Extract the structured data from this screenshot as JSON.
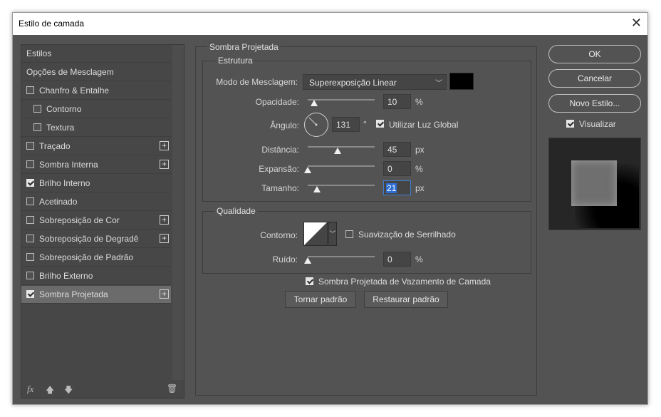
{
  "window": {
    "title": "Estilo de camada"
  },
  "left_panel": {
    "items": [
      {
        "label": "Estilos",
        "checkbox": null,
        "plus": false,
        "selected": false
      },
      {
        "label": "Opções de Mesclagem",
        "checkbox": null,
        "plus": false,
        "selected": false
      },
      {
        "label": "Chanfro & Entalhe",
        "checkbox": false,
        "plus": false,
        "selected": false
      },
      {
        "label": "Contorno",
        "checkbox": false,
        "plus": false,
        "selected": false,
        "indent": true
      },
      {
        "label": "Textura",
        "checkbox": false,
        "plus": false,
        "selected": false,
        "indent": true
      },
      {
        "label": "Traçado",
        "checkbox": false,
        "plus": true,
        "selected": false
      },
      {
        "label": "Sombra Interna",
        "checkbox": false,
        "plus": true,
        "selected": false
      },
      {
        "label": "Brilho Interno",
        "checkbox": true,
        "plus": false,
        "selected": false
      },
      {
        "label": "Acetinado",
        "checkbox": false,
        "plus": false,
        "selected": false
      },
      {
        "label": "Sobreposição de Cor",
        "checkbox": false,
        "plus": true,
        "selected": false
      },
      {
        "label": "Sobreposição de Degradê",
        "checkbox": false,
        "plus": true,
        "selected": false
      },
      {
        "label": "Sobreposição de Padrão",
        "checkbox": false,
        "plus": false,
        "selected": false
      },
      {
        "label": "Brilho Externo",
        "checkbox": false,
        "plus": false,
        "selected": false
      },
      {
        "label": "Sombra Projetada",
        "checkbox": true,
        "plus": true,
        "selected": true
      }
    ],
    "footer": {
      "fx": "fx",
      "up_icon": "arrow-up-icon",
      "down_icon": "arrow-down-icon",
      "trash_icon": "trash-icon"
    }
  },
  "panel": {
    "group_title": "Sombra Projetada",
    "structure": {
      "title": "Estrutura",
      "blend_mode_label": "Modo de Mesclagem:",
      "blend_mode_value": "Superexposição Linear",
      "color": "#000000",
      "opacity_label": "Opacidade:",
      "opacity_value": "10",
      "opacity_unit": "%",
      "opacity_level": 0.1,
      "angle_label": "Ângulo:",
      "angle_value": "131",
      "angle_unit": "°",
      "global_light_label": "Utilizar Luz Global",
      "global_light_checked": true,
      "distance_label": "Distância:",
      "distance_value": "45",
      "distance_unit": "px",
      "distance_level": 0.45,
      "spread_label": "Expansão:",
      "spread_value": "0",
      "spread_unit": "%",
      "spread_level": 0,
      "size_label": "Tamanho:",
      "size_value": "21",
      "size_unit": "px",
      "size_level": 0.14
    },
    "quality": {
      "title": "Qualidade",
      "contour_label": "Contorno:",
      "antialias_label": "Suavização de Serrilhado",
      "antialias_checked": false,
      "noise_label": "Ruído:",
      "noise_value": "0",
      "noise_unit": "%",
      "noise_level": 0
    },
    "knockout_label": "Sombra Projetada de Vazamento de Camada",
    "knockout_checked": true,
    "make_default": "Tornar padrão",
    "reset_default": "Restaurar padrão"
  },
  "right": {
    "ok": "OK",
    "cancel": "Cancelar",
    "new_style": "Novo Estilo...",
    "preview_label": "Visualizar",
    "preview_checked": true
  }
}
